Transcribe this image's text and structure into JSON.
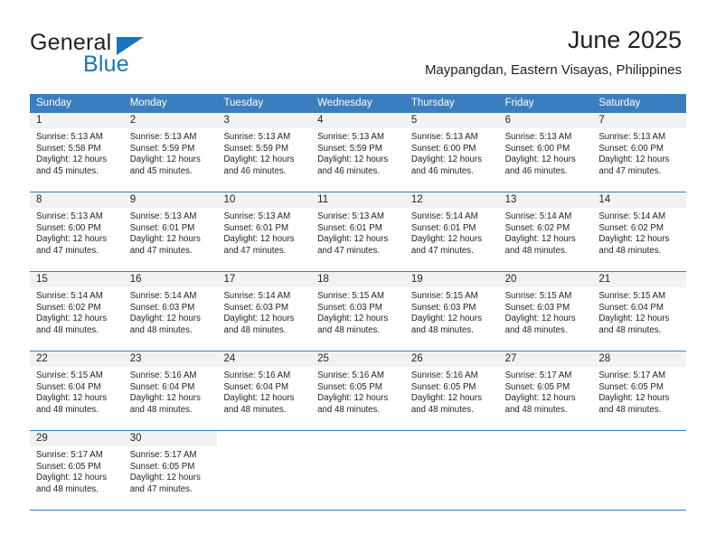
{
  "brand": {
    "name_part1": "General",
    "name_part2": "Blue",
    "color_primary": "#1b75bb",
    "color_text": "#231f20"
  },
  "header": {
    "title": "June 2025",
    "subtitle": "Maypangdan, Eastern Visayas, Philippines"
  },
  "calendar": {
    "header_bg": "#3a7ebf",
    "header_text_color": "#ffffff",
    "daynum_bg": "#f2f2f2",
    "weekdays": [
      "Sunday",
      "Monday",
      "Tuesday",
      "Wednesday",
      "Thursday",
      "Friday",
      "Saturday"
    ],
    "weeks": [
      [
        {
          "day": "1",
          "sunrise": "Sunrise: 5:13 AM",
          "sunset": "Sunset: 5:58 PM",
          "daylight_line1": "Daylight: 12 hours",
          "daylight_line2": "and 45 minutes."
        },
        {
          "day": "2",
          "sunrise": "Sunrise: 5:13 AM",
          "sunset": "Sunset: 5:59 PM",
          "daylight_line1": "Daylight: 12 hours",
          "daylight_line2": "and 45 minutes."
        },
        {
          "day": "3",
          "sunrise": "Sunrise: 5:13 AM",
          "sunset": "Sunset: 5:59 PM",
          "daylight_line1": "Daylight: 12 hours",
          "daylight_line2": "and 46 minutes."
        },
        {
          "day": "4",
          "sunrise": "Sunrise: 5:13 AM",
          "sunset": "Sunset: 5:59 PM",
          "daylight_line1": "Daylight: 12 hours",
          "daylight_line2": "and 46 minutes."
        },
        {
          "day": "5",
          "sunrise": "Sunrise: 5:13 AM",
          "sunset": "Sunset: 6:00 PM",
          "daylight_line1": "Daylight: 12 hours",
          "daylight_line2": "and 46 minutes."
        },
        {
          "day": "6",
          "sunrise": "Sunrise: 5:13 AM",
          "sunset": "Sunset: 6:00 PM",
          "daylight_line1": "Daylight: 12 hours",
          "daylight_line2": "and 46 minutes."
        },
        {
          "day": "7",
          "sunrise": "Sunrise: 5:13 AM",
          "sunset": "Sunset: 6:00 PM",
          "daylight_line1": "Daylight: 12 hours",
          "daylight_line2": "and 47 minutes."
        }
      ],
      [
        {
          "day": "8",
          "sunrise": "Sunrise: 5:13 AM",
          "sunset": "Sunset: 6:00 PM",
          "daylight_line1": "Daylight: 12 hours",
          "daylight_line2": "and 47 minutes."
        },
        {
          "day": "9",
          "sunrise": "Sunrise: 5:13 AM",
          "sunset": "Sunset: 6:01 PM",
          "daylight_line1": "Daylight: 12 hours",
          "daylight_line2": "and 47 minutes."
        },
        {
          "day": "10",
          "sunrise": "Sunrise: 5:13 AM",
          "sunset": "Sunset: 6:01 PM",
          "daylight_line1": "Daylight: 12 hours",
          "daylight_line2": "and 47 minutes."
        },
        {
          "day": "11",
          "sunrise": "Sunrise: 5:13 AM",
          "sunset": "Sunset: 6:01 PM",
          "daylight_line1": "Daylight: 12 hours",
          "daylight_line2": "and 47 minutes."
        },
        {
          "day": "12",
          "sunrise": "Sunrise: 5:14 AM",
          "sunset": "Sunset: 6:01 PM",
          "daylight_line1": "Daylight: 12 hours",
          "daylight_line2": "and 47 minutes."
        },
        {
          "day": "13",
          "sunrise": "Sunrise: 5:14 AM",
          "sunset": "Sunset: 6:02 PM",
          "daylight_line1": "Daylight: 12 hours",
          "daylight_line2": "and 48 minutes."
        },
        {
          "day": "14",
          "sunrise": "Sunrise: 5:14 AM",
          "sunset": "Sunset: 6:02 PM",
          "daylight_line1": "Daylight: 12 hours",
          "daylight_line2": "and 48 minutes."
        }
      ],
      [
        {
          "day": "15",
          "sunrise": "Sunrise: 5:14 AM",
          "sunset": "Sunset: 6:02 PM",
          "daylight_line1": "Daylight: 12 hours",
          "daylight_line2": "and 48 minutes."
        },
        {
          "day": "16",
          "sunrise": "Sunrise: 5:14 AM",
          "sunset": "Sunset: 6:03 PM",
          "daylight_line1": "Daylight: 12 hours",
          "daylight_line2": "and 48 minutes."
        },
        {
          "day": "17",
          "sunrise": "Sunrise: 5:14 AM",
          "sunset": "Sunset: 6:03 PM",
          "daylight_line1": "Daylight: 12 hours",
          "daylight_line2": "and 48 minutes."
        },
        {
          "day": "18",
          "sunrise": "Sunrise: 5:15 AM",
          "sunset": "Sunset: 6:03 PM",
          "daylight_line1": "Daylight: 12 hours",
          "daylight_line2": "and 48 minutes."
        },
        {
          "day": "19",
          "sunrise": "Sunrise: 5:15 AM",
          "sunset": "Sunset: 6:03 PM",
          "daylight_line1": "Daylight: 12 hours",
          "daylight_line2": "and 48 minutes."
        },
        {
          "day": "20",
          "sunrise": "Sunrise: 5:15 AM",
          "sunset": "Sunset: 6:03 PM",
          "daylight_line1": "Daylight: 12 hours",
          "daylight_line2": "and 48 minutes."
        },
        {
          "day": "21",
          "sunrise": "Sunrise: 5:15 AM",
          "sunset": "Sunset: 6:04 PM",
          "daylight_line1": "Daylight: 12 hours",
          "daylight_line2": "and 48 minutes."
        }
      ],
      [
        {
          "day": "22",
          "sunrise": "Sunrise: 5:15 AM",
          "sunset": "Sunset: 6:04 PM",
          "daylight_line1": "Daylight: 12 hours",
          "daylight_line2": "and 48 minutes."
        },
        {
          "day": "23",
          "sunrise": "Sunrise: 5:16 AM",
          "sunset": "Sunset: 6:04 PM",
          "daylight_line1": "Daylight: 12 hours",
          "daylight_line2": "and 48 minutes."
        },
        {
          "day": "24",
          "sunrise": "Sunrise: 5:16 AM",
          "sunset": "Sunset: 6:04 PM",
          "daylight_line1": "Daylight: 12 hours",
          "daylight_line2": "and 48 minutes."
        },
        {
          "day": "25",
          "sunrise": "Sunrise: 5:16 AM",
          "sunset": "Sunset: 6:05 PM",
          "daylight_line1": "Daylight: 12 hours",
          "daylight_line2": "and 48 minutes."
        },
        {
          "day": "26",
          "sunrise": "Sunrise: 5:16 AM",
          "sunset": "Sunset: 6:05 PM",
          "daylight_line1": "Daylight: 12 hours",
          "daylight_line2": "and 48 minutes."
        },
        {
          "day": "27",
          "sunrise": "Sunrise: 5:17 AM",
          "sunset": "Sunset: 6:05 PM",
          "daylight_line1": "Daylight: 12 hours",
          "daylight_line2": "and 48 minutes."
        },
        {
          "day": "28",
          "sunrise": "Sunrise: 5:17 AM",
          "sunset": "Sunset: 6:05 PM",
          "daylight_line1": "Daylight: 12 hours",
          "daylight_line2": "and 48 minutes."
        }
      ],
      [
        {
          "day": "29",
          "sunrise": "Sunrise: 5:17 AM",
          "sunset": "Sunset: 6:05 PM",
          "daylight_line1": "Daylight: 12 hours",
          "daylight_line2": "and 48 minutes."
        },
        {
          "day": "30",
          "sunrise": "Sunrise: 5:17 AM",
          "sunset": "Sunset: 6:05 PM",
          "daylight_line1": "Daylight: 12 hours",
          "daylight_line2": "and 47 minutes."
        },
        {
          "day": "",
          "sunrise": "",
          "sunset": "",
          "daylight_line1": "",
          "daylight_line2": ""
        },
        {
          "day": "",
          "sunrise": "",
          "sunset": "",
          "daylight_line1": "",
          "daylight_line2": ""
        },
        {
          "day": "",
          "sunrise": "",
          "sunset": "",
          "daylight_line1": "",
          "daylight_line2": ""
        },
        {
          "day": "",
          "sunrise": "",
          "sunset": "",
          "daylight_line1": "",
          "daylight_line2": ""
        },
        {
          "day": "",
          "sunrise": "",
          "sunset": "",
          "daylight_line1": "",
          "daylight_line2": ""
        }
      ]
    ]
  }
}
